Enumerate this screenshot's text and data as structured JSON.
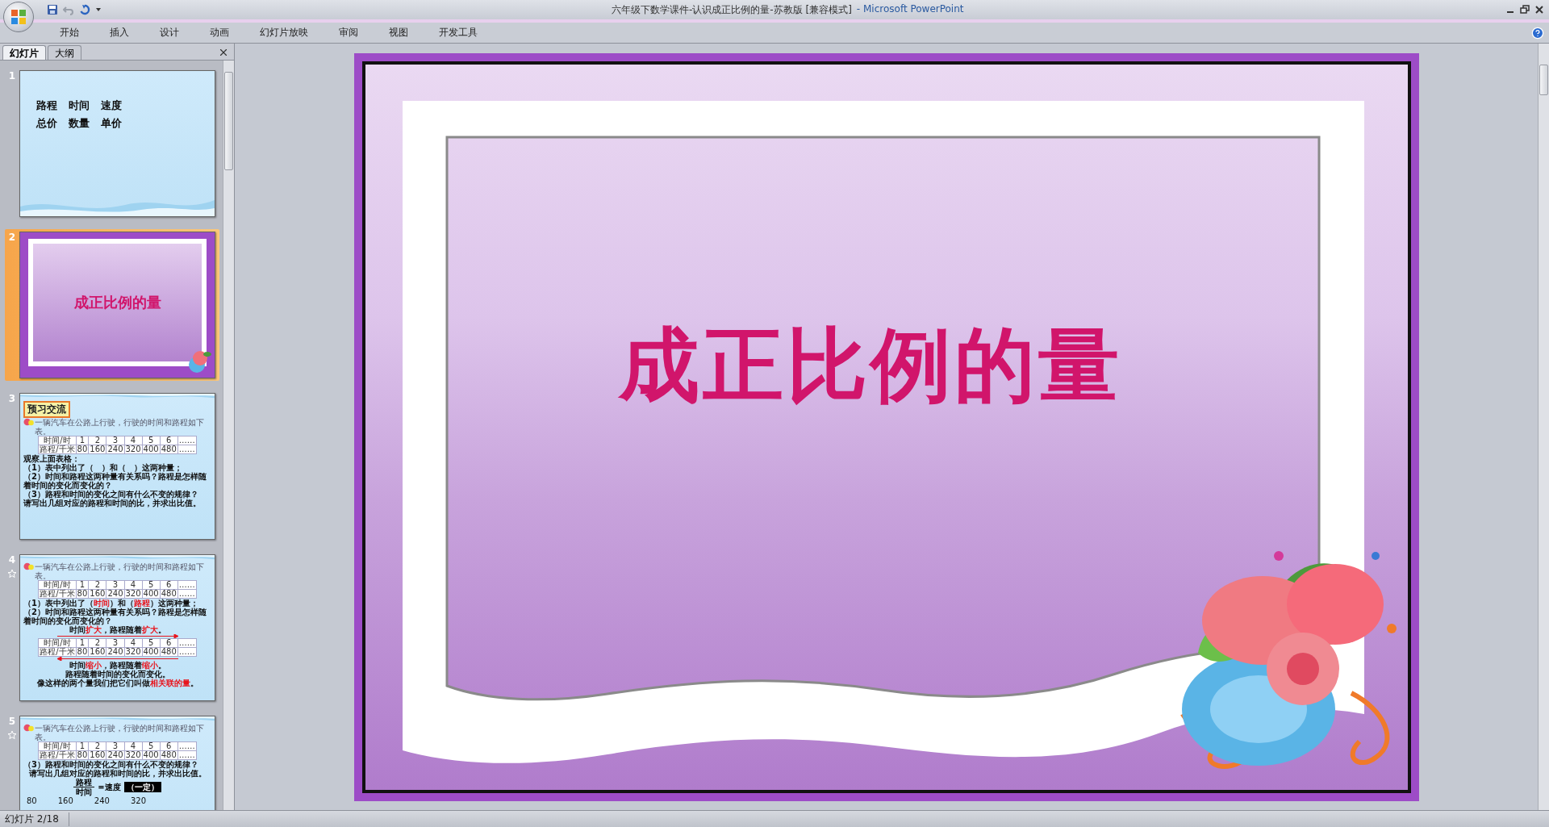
{
  "window": {
    "document_title": "六年级下数学课件-认识成正比例的量-苏教版 [兼容模式]",
    "app_title": "- Microsoft PowerPoint"
  },
  "ribbon_tabs": [
    {
      "label": "开始"
    },
    {
      "label": "插入"
    },
    {
      "label": "设计"
    },
    {
      "label": "动画"
    },
    {
      "label": "幻灯片放映"
    },
    {
      "label": "审阅"
    },
    {
      "label": "视图"
    },
    {
      "label": "开发工具"
    }
  ],
  "pane_tabs": [
    {
      "label": "幻灯片",
      "selected": true
    },
    {
      "label": "大纲",
      "selected": false
    }
  ],
  "slides": [
    {
      "number": "1",
      "selected": false,
      "animated": false,
      "kind": "words",
      "rows": [
        [
          "路程",
          "时间",
          "速度"
        ],
        [
          "总价",
          "数量",
          "单价"
        ]
      ]
    },
    {
      "number": "2",
      "selected": true,
      "animated": false,
      "kind": "title",
      "title": "成正比例的量"
    },
    {
      "number": "3",
      "selected": false,
      "animated": false,
      "kind": "exercise",
      "blocks": [
        {
          "kind": "heading",
          "text": "预习交流"
        },
        {
          "kind": "example",
          "text": "一辆汽车在公路上行驶，行驶的时间和路程如下表。"
        },
        {
          "kind": "table",
          "rows": [
            [
              "时间/时",
              "1",
              "2",
              "3",
              "4",
              "5",
              "6",
              "……"
            ],
            [
              "路程/千米",
              "80",
              "160",
              "240",
              "320",
              "400",
              "480",
              "……"
            ]
          ]
        },
        {
          "kind": "text",
          "centered": false,
          "parts": [
            {
              "text": "观察上面表格：",
              "highlight": false
            }
          ]
        },
        {
          "kind": "text",
          "centered": false,
          "parts": [
            {
              "text": "（1）表中列出了（　）和（　）这两种量；",
              "highlight": false
            }
          ]
        },
        {
          "kind": "text",
          "centered": false,
          "parts": [
            {
              "text": "（2）时间和路程这两种量有关系吗？路程是怎样随着时间的变化而变化的？",
              "highlight": false
            }
          ]
        },
        {
          "kind": "text",
          "centered": false,
          "parts": [
            {
              "text": "（3）路程和时间的变化之间有什么不变的规律？",
              "highlight": false
            }
          ]
        },
        {
          "kind": "text",
          "centered": false,
          "parts": [
            {
              "text": "请写出几组对应的路程和时间的比，并求出比值。",
              "highlight": false
            }
          ]
        }
      ]
    },
    {
      "number": "4",
      "selected": false,
      "animated": true,
      "kind": "exercise",
      "blocks": [
        {
          "kind": "example",
          "text": "一辆汽车在公路上行驶，行驶的时间和路程如下表。"
        },
        {
          "kind": "table",
          "rows": [
            [
              "时间/时",
              "1",
              "2",
              "3",
              "4",
              "5",
              "6",
              "……"
            ],
            [
              "路程/千米",
              "80",
              "160",
              "240",
              "320",
              "400",
              "480",
              "……"
            ]
          ]
        },
        {
          "kind": "text",
          "centered": false,
          "parts": [
            {
              "text": "（1）表中列出了（",
              "highlight": false
            },
            {
              "text": "时间",
              "highlight": true
            },
            {
              "text": "）和（",
              "highlight": false
            },
            {
              "text": "路程",
              "highlight": true
            },
            {
              "text": "）这两种量；",
              "highlight": false
            }
          ]
        },
        {
          "kind": "text",
          "centered": false,
          "parts": [
            {
              "text": "（2）时间和路程这两种量有关系吗？路程是怎样随着时间的变化而变化的？",
              "highlight": false
            }
          ]
        },
        {
          "kind": "text",
          "centered": true,
          "parts": [
            {
              "text": "时间",
              "highlight": false
            },
            {
              "text": "扩大",
              "highlight": true
            },
            {
              "text": "，路程随着",
              "highlight": false
            },
            {
              "text": "扩大",
              "highlight": true
            },
            {
              "text": "。",
              "highlight": false
            }
          ]
        },
        {
          "kind": "arrow",
          "points_left": false
        },
        {
          "kind": "table",
          "rows": [
            [
              "时间/时",
              "1",
              "2",
              "3",
              "4",
              "5",
              "6",
              "……"
            ],
            [
              "路程/千米",
              "80",
              "160",
              "240",
              "320",
              "400",
              "480",
              "……"
            ]
          ]
        },
        {
          "kind": "arrow",
          "points_left": true
        },
        {
          "kind": "text",
          "centered": true,
          "parts": [
            {
              "text": "时间",
              "highlight": false
            },
            {
              "text": "缩小",
              "highlight": true
            },
            {
              "text": "，路程随着",
              "highlight": false
            },
            {
              "text": "缩小",
              "highlight": true
            },
            {
              "text": "。",
              "highlight": false
            }
          ]
        },
        {
          "kind": "text",
          "centered": true,
          "parts": [
            {
              "text": "路程随着时间的变化而变化。",
              "highlight": false
            }
          ]
        },
        {
          "kind": "text",
          "centered": true,
          "parts": [
            {
              "text": "像这样的两个量我们把它们叫做",
              "highlight": false
            },
            {
              "text": "相关联的量",
              "highlight": true
            },
            {
              "text": "。",
              "highlight": false
            }
          ]
        }
      ]
    },
    {
      "number": "5",
      "selected": false,
      "animated": true,
      "kind": "exercise",
      "blocks": [
        {
          "kind": "example",
          "text": "一辆汽车在公路上行驶，行驶的时间和路程如下表。"
        },
        {
          "kind": "table",
          "rows": [
            [
              "时间/时",
              "1",
              "2",
              "3",
              "4",
              "5",
              "6",
              "……"
            ],
            [
              "路程/千米",
              "80",
              "160",
              "240",
              "320",
              "400",
              "480",
              "……"
            ]
          ]
        },
        {
          "kind": "text",
          "centered": false,
          "parts": [
            {
              "text": "（3）路程和时间的变化之间有什么不变的规律？",
              "highlight": false
            }
          ]
        },
        {
          "kind": "text",
          "centered": true,
          "parts": [
            {
              "text": "请写出几组对应的路程和时间的比，并求出比值。",
              "highlight": false
            }
          ]
        },
        {
          "kind": "fraction",
          "numerator": "路程",
          "denominator": "时间",
          "equals": "=速度",
          "note": "（一定）"
        },
        {
          "kind": "numbers",
          "values": [
            "80",
            "160",
            "240",
            "320"
          ]
        }
      ]
    }
  ],
  "current_slide": {
    "title": "成正比例的量"
  },
  "status_bar": {
    "slide_info": "幻灯片 2/18"
  }
}
